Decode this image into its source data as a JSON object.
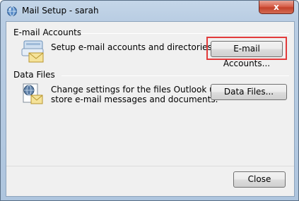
{
  "window": {
    "title": "Mail Setup - sarah",
    "close_glyph": "x"
  },
  "email_accounts": {
    "group_label": "E-mail Accounts",
    "description": "Setup e-mail accounts and directories.",
    "button_label": "E-mail Accounts...",
    "icon": "mail-accounts-icon"
  },
  "data_files": {
    "group_label": "Data Files",
    "description_line1": "Change settings for the files Outlook uses to",
    "description_line2": "store e-mail messages and documents.",
    "button_label": "Data Files...",
    "icon": "data-files-icon"
  },
  "footer": {
    "close_label": "Close"
  },
  "colors": {
    "highlight": "#e23b3b",
    "dialog_bg": "#f0f0f0"
  }
}
